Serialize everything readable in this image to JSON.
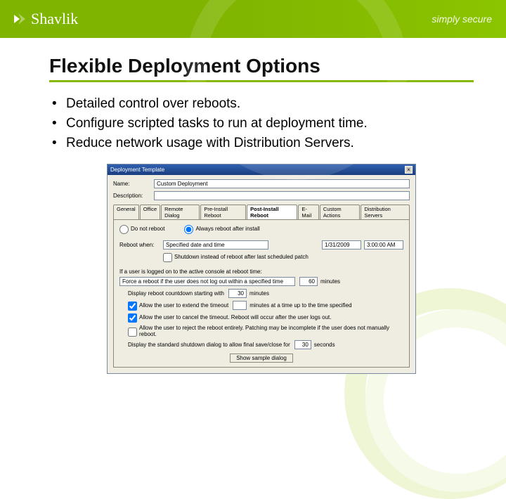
{
  "header": {
    "brand": "Shavlik",
    "tagline": "simply secure"
  },
  "slide": {
    "title": "Flexible Deployment Options",
    "bullets": [
      "Detailed control over reboots.",
      "Configure scripted tasks to run at deployment time.",
      "Reduce network usage with Distribution Servers."
    ]
  },
  "dialog": {
    "title": "Deployment Template",
    "close": "×",
    "name_label": "Name:",
    "name_value": "Custom Deployment",
    "desc_label": "Description:",
    "desc_value": "",
    "tabs": [
      "General",
      "Office",
      "Remote Dialog",
      "Pre-Install Reboot",
      "Post-Install Reboot",
      "E-Mail",
      "Custom Actions",
      "Distribution Servers"
    ],
    "active_tab": "Post-Install Reboot",
    "opt_noreboot": "Do not reboot",
    "opt_always": "Always reboot after install",
    "reboot_when_label": "Reboot when:",
    "reboot_when_value": "Specified date and time",
    "date_value": "1/31/2009",
    "time_value": "3:00:00 AM",
    "chk_shutdown": "Shutdown instead of reboot after last scheduled patch",
    "section_label": "If a user is logged on to the active console at reboot time:",
    "force_option": "Force a reboot if the user does not log out within a specified time",
    "minutes_word": "minutes",
    "countdown_label": "Display reboot countdown starting with",
    "countdown_value": "30",
    "timeout_value": "60",
    "chk_extend": "Allow the user to extend the timeout",
    "extend_tail": "minutes at a time up to the time specified",
    "chk_cancel": "Allow the user to cancel the timeout. Reboot will occur after the user logs out.",
    "chk_reject": "Allow the user to reject the reboot entirely. Patching may be incomplete if the user does not manually reboot.",
    "stddlg_label": "Display the standard shutdown dialog to allow final save/close for",
    "stddlg_value": "30",
    "seconds_word": "seconds",
    "sample_btn": "Show sample dialog"
  }
}
